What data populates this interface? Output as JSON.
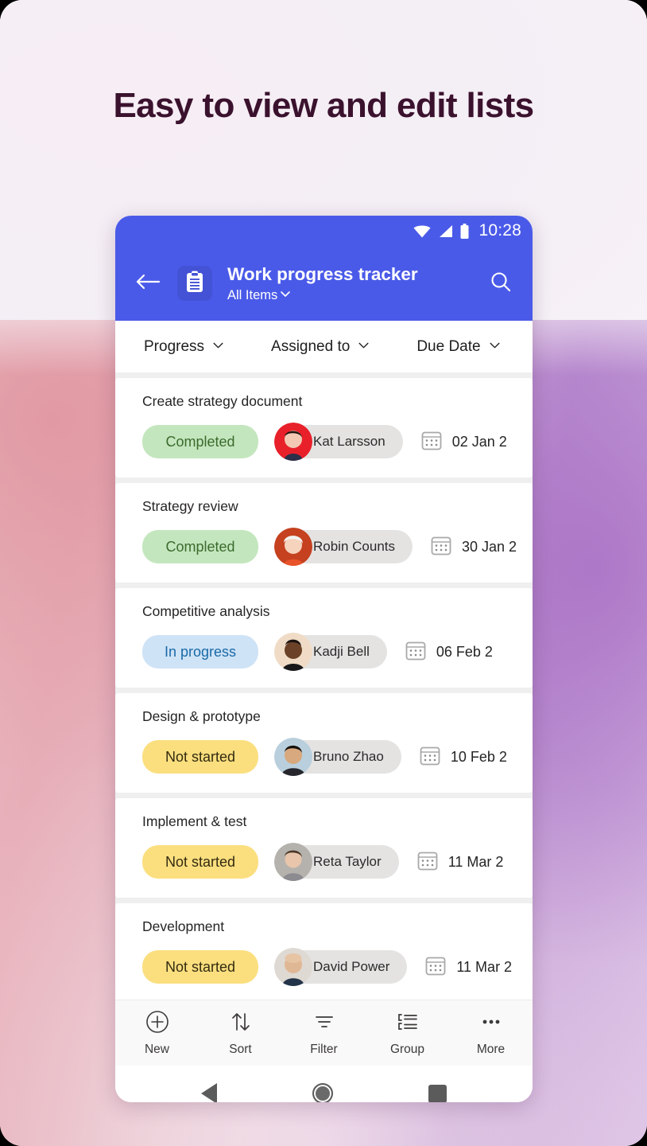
{
  "headline": "Easy to view and edit lists",
  "colors": {
    "accent_blue": "#4a5ae8",
    "headline": "#3b122e",
    "pill_completed_bg": "#c4e6be",
    "pill_completed_text": "#3b6b2d",
    "pill_inprogress_bg": "#cfe3f6",
    "pill_inprogress_text": "#1a6aa8",
    "pill_notstarted_bg": "#fbdf7f",
    "pill_notstarted_text": "#332b10"
  },
  "status_bar": {
    "time": "10:28",
    "icons": [
      "wifi-icon",
      "cellular-signal-icon",
      "battery-icon"
    ]
  },
  "app_bar": {
    "back_icon": "back-arrow-icon",
    "list_icon": "clipboard-icon",
    "title": "Work progress tracker",
    "view_name": "All Items",
    "view_chevron": "chevron-down-icon",
    "search_icon": "search-icon"
  },
  "columns": [
    {
      "label": "Progress",
      "chevron": "chevron-down-icon"
    },
    {
      "label": "Assigned to",
      "chevron": "chevron-down-icon"
    },
    {
      "label": "Due Date",
      "chevron": "chevron-down-icon"
    }
  ],
  "rows": [
    {
      "task": "Create strategy document",
      "status": "Completed",
      "status_style": "completed",
      "person": "Kat Larsson",
      "due": "02 Jan 2"
    },
    {
      "task": "Strategy review",
      "status": "Completed",
      "status_style": "completed",
      "person": "Robin Counts",
      "due": "30 Jan 2"
    },
    {
      "task": "Competitive analysis",
      "status": "In progress",
      "status_style": "inprogress",
      "person": "Kadji Bell",
      "due": "06 Feb 2"
    },
    {
      "task": "Design & prototype",
      "status": "Not started",
      "status_style": "notstarted",
      "person": "Bruno Zhao",
      "due": "10 Feb 2"
    },
    {
      "task": "Implement & test",
      "status": "Not started",
      "status_style": "notstarted",
      "person": "Reta Taylor",
      "due": "11 Mar 2"
    },
    {
      "task": "Development",
      "status": "Not started",
      "status_style": "notstarted",
      "person": "David Power",
      "due": "11 Mar 2"
    }
  ],
  "command_bar": [
    {
      "label": "New",
      "icon": "plus-circle-icon"
    },
    {
      "label": "Sort",
      "icon": "sort-arrows-icon"
    },
    {
      "label": "Filter",
      "icon": "filter-icon"
    },
    {
      "label": "Group",
      "icon": "group-list-icon"
    },
    {
      "label": "More",
      "icon": "ellipsis-icon"
    }
  ],
  "nav_bar": {
    "back": "android-back-icon",
    "home": "android-home-icon",
    "recent": "android-recents-icon"
  }
}
